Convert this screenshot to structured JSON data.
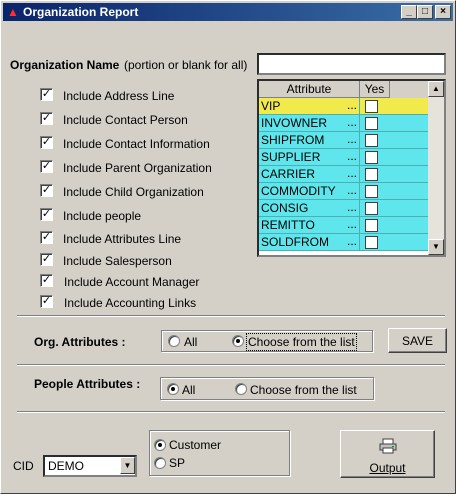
{
  "window": {
    "title": "Organization Report",
    "minimize": "_",
    "maximize": "□",
    "close": "×"
  },
  "org_name": {
    "label": "Organization Name",
    "hint": "(portion or blank for all)",
    "value": ""
  },
  "options": [
    {
      "label": "Include Address Line",
      "checked": true
    },
    {
      "label": "Include Contact Person",
      "checked": true
    },
    {
      "label": "Include Contact Information",
      "checked": true
    },
    {
      "label": "Include Parent Organization",
      "checked": true
    },
    {
      "label": "Include Child Organization",
      "checked": true
    },
    {
      "label": "Include people",
      "checked": true
    },
    {
      "label": "Include Attributes Line",
      "checked": true
    },
    {
      "label": "Include Salesperson",
      "checked": true
    },
    {
      "label": "Include  Account Manager",
      "checked": true
    },
    {
      "label": "Include Accounting Links",
      "checked": true
    }
  ],
  "attributes_grid": {
    "col_attribute": "Attribute",
    "col_yes": "Yes",
    "rows": [
      {
        "name": "VIP",
        "dots": "...",
        "yes": false,
        "selected": true
      },
      {
        "name": "INVOWNER",
        "dots": "...",
        "yes": false
      },
      {
        "name": "SHIPFROM",
        "dots": "...",
        "yes": false
      },
      {
        "name": "SUPPLIER",
        "dots": "...",
        "yes": false
      },
      {
        "name": "CARRIER",
        "dots": "...",
        "yes": false
      },
      {
        "name": "COMMODITY",
        "dots": "...",
        "yes": false
      },
      {
        "name": "CONSIG",
        "dots": "...",
        "yes": false
      },
      {
        "name": "REMITTO",
        "dots": "...",
        "yes": false
      },
      {
        "name": "SOLDFROM",
        "dots": "...",
        "yes": false
      }
    ]
  },
  "org_attributes": {
    "label": "Org. Attributes :",
    "option_all": "All",
    "option_choose": "Choose from the list",
    "selected": "choose"
  },
  "save_button": "SAVE",
  "people_attributes": {
    "label": "People Attributes :",
    "option_all": "All",
    "option_choose": "Choose from the list",
    "selected": "all"
  },
  "cid": {
    "label": "CID",
    "value": "DEMO"
  },
  "target": {
    "option_customer": "Customer",
    "option_sp": "SP",
    "selected": "customer"
  },
  "output_button": "Output",
  "colors": {
    "row_bg": "#5ee6ec",
    "row_selected": "#f0ea4c",
    "titlebar": "#0a246a"
  }
}
